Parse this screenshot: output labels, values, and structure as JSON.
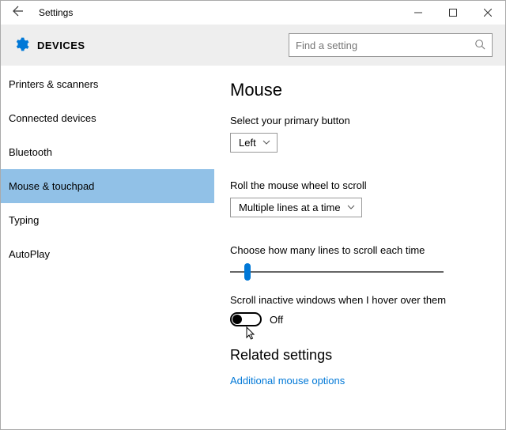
{
  "titlebar": {
    "title": "Settings"
  },
  "header": {
    "section": "DEVICES",
    "search_placeholder": "Find a setting"
  },
  "sidebar": {
    "items": [
      {
        "label": "Printers & scanners"
      },
      {
        "label": "Connected devices"
      },
      {
        "label": "Bluetooth"
      },
      {
        "label": "Mouse & touchpad"
      },
      {
        "label": "Typing"
      },
      {
        "label": "AutoPlay"
      }
    ],
    "selected_index": 3
  },
  "content": {
    "page_title": "Mouse",
    "primary_button": {
      "label": "Select your primary button",
      "value": "Left"
    },
    "scroll_mode": {
      "label": "Roll the mouse wheel to scroll",
      "value": "Multiple lines at a time"
    },
    "lines_slider": {
      "label": "Choose how many lines to scroll each time",
      "percent": 8
    },
    "hover_scroll": {
      "label": "Scroll inactive windows when I hover over them",
      "state": "Off"
    },
    "related": {
      "heading": "Related settings",
      "link": "Additional mouse options"
    }
  }
}
